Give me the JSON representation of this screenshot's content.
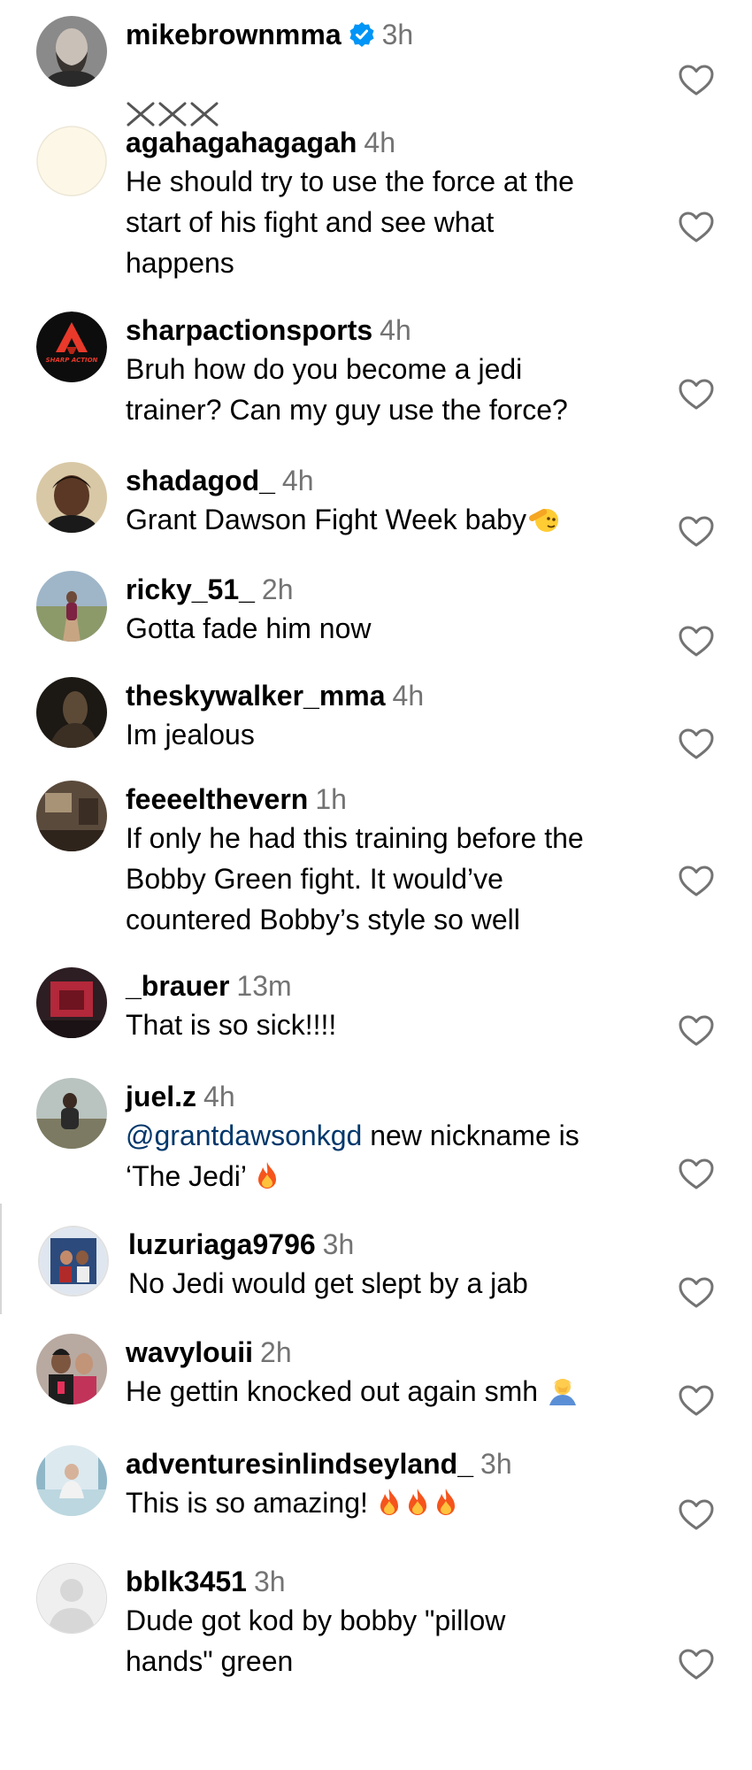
{
  "colors": {
    "text": "#000000",
    "secondary": "#737373",
    "mention": "#00376b",
    "verified": "#0095f6"
  },
  "comments": [
    {
      "username": "mikebrownmma",
      "verified": true,
      "time": "3h",
      "text": "",
      "emoji": "crossed-swords-x3",
      "avatar": "bearded-man-photo"
    },
    {
      "username": "agahagahagagah",
      "time": "4h",
      "text": "He should try to use the force at the\nstart of his fight and see what\nhappens",
      "avatar": "blank-cream"
    },
    {
      "username": "sharpactionsports",
      "time": "4h",
      "text": "Bruh how do you become a jedi\ntrainer? Can my guy use the force?",
      "avatar": "sharp-action-logo",
      "avatar_label": "SHARP ACTION"
    },
    {
      "username": "shadagod_",
      "time": "4h",
      "text": "Grant Dawson Fight Week baby",
      "emoji": "saluting-face",
      "avatar": "man-photo"
    },
    {
      "username": "ricky_51_",
      "time": "2h",
      "text": "Gotta fade him now",
      "avatar": "trail-photo"
    },
    {
      "username": "theskywalker_mma",
      "time": "4h",
      "text": "Im jealous",
      "avatar": "dark-photo"
    },
    {
      "username": "feeeelthevern",
      "time": "1h",
      "text": "If only he had this training before the\nBobby Green fight. It would’ve\ncountered Bobby’s style so well",
      "avatar": "room-photo"
    },
    {
      "username": "_brauer",
      "time": "13m",
      "text": "That is so sick!!!!",
      "avatar": "red-photo"
    },
    {
      "username": "juel.z",
      "time": "4h",
      "mention": "@grantdawsonkgd",
      "text": " new nickname is\n‘The Jedi’",
      "emoji": "fire",
      "avatar": "outdoor-photo"
    },
    {
      "username": "luzuriaga9796",
      "time": "3h",
      "text": "No Jedi would get slept by a jab",
      "avatar": "fighters-photo"
    },
    {
      "username": "wavylouii",
      "time": "2h",
      "text": "He gettin knocked out again smh",
      "emoji": "person-facepalming",
      "avatar": "couple-photo"
    },
    {
      "username": "adventuresinlindseyland_",
      "time": "3h",
      "text": "This is so amazing!",
      "emoji": "fire-x3",
      "avatar": "park-photo"
    },
    {
      "username": "bblk3451",
      "time": "3h",
      "text": "Dude got kod by bobby \"pillow\nhands\" green",
      "avatar": "default-person"
    }
  ]
}
